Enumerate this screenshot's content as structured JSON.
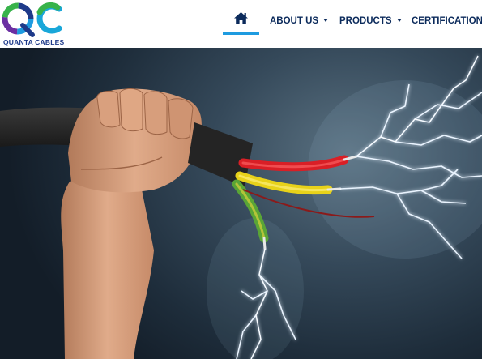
{
  "brand": {
    "name": "QUANTA CABLES",
    "logo_letters": "QC",
    "colors": {
      "navy": "#0b2a5b",
      "blue": "#1e9be0",
      "green": "#37b34a",
      "purple": "#6b2fa2",
      "cyan": "#19a7d9"
    }
  },
  "nav": {
    "home_icon": "home-icon",
    "items": [
      {
        "label": "ABOUT US",
        "dropdown": true
      },
      {
        "label": "PRODUCTS",
        "dropdown": true
      },
      {
        "label": "CERTIFICATION",
        "dropdown": false
      }
    ],
    "active": "home"
  },
  "hero": {
    "image": "hand-holding-cable-with-lightning",
    "wires": [
      "red",
      "yellow",
      "green"
    ]
  }
}
